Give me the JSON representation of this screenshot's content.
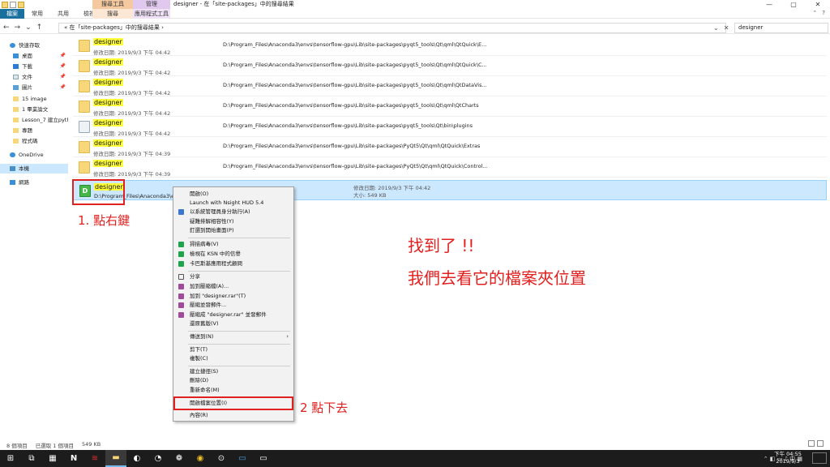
{
  "window": {
    "title": "designer - 在「site-packages」中的搜尋結果",
    "ctx_search_label": "搜尋工具",
    "ctx_manage_label": "管理",
    "ctrl_min": "—",
    "ctrl_max": "▢",
    "ctrl_close": "✕"
  },
  "ribbon": {
    "tabs": [
      "檔案",
      "常用",
      "共用",
      "檢視"
    ],
    "ctx_tabs": [
      "搜尋",
      "應用程式工具"
    ],
    "right": [
      "⌃",
      "?"
    ]
  },
  "address": {
    "path": "« 在「site-packages」中的搜尋結果 ›",
    "search_value": "designer",
    "nav_back": "←",
    "nav_forward": "→",
    "nav_recent": "⌄",
    "nav_up": "↑",
    "dropdown": "⌄",
    "close": "✕"
  },
  "sidebar": {
    "items": [
      {
        "label": "快速存取",
        "pinned": false
      },
      {
        "label": "桌面",
        "pinned": true
      },
      {
        "label": "下載",
        "pinned": true
      },
      {
        "label": "文件",
        "pinned": true
      },
      {
        "label": "圖片",
        "pinned": true
      },
      {
        "label": "15 image",
        "pinned": false
      },
      {
        "label": "1 畢業論文",
        "pinned": false
      },
      {
        "label": "Lesson_7 建立pyth",
        "pinned": false
      },
      {
        "label": "專題",
        "pinned": false
      },
      {
        "label": "程式碼",
        "pinned": false
      },
      {
        "label": "OneDrive",
        "pinned": false
      },
      {
        "label": "本機",
        "pinned": false
      },
      {
        "label": "網路",
        "pinned": false
      }
    ],
    "pin_glyph": "📌"
  },
  "results": [
    {
      "name": "designer",
      "meta": "修改日期: 2019/9/3 下午 04:42",
      "path": "D:\\Program_Files\\Anaconda3\\envs\\tensorflow-gpu\\Lib\\site-packages\\pyqt5_tools\\Qt\\qml\\QtQuick\\E..."
    },
    {
      "name": "designer",
      "meta": "修改日期: 2019/9/3 下午 04:42",
      "path": "D:\\Program_Files\\Anaconda3\\envs\\tensorflow-gpu\\Lib\\site-packages\\pyqt5_tools\\Qt\\qml\\QtQuick\\C..."
    },
    {
      "name": "designer",
      "meta": "修改日期: 2019/9/3 下午 04:42",
      "path": "D:\\Program_Files\\Anaconda3\\envs\\tensorflow-gpu\\Lib\\site-packages\\pyqt5_tools\\Qt\\qml\\QtDataVis..."
    },
    {
      "name": "designer",
      "meta": "修改日期: 2019/9/3 下午 04:42",
      "path": "D:\\Program_Files\\Anaconda3\\envs\\tensorflow-gpu\\Lib\\site-packages\\pyqt5_tools\\Qt\\qml\\QtCharts"
    },
    {
      "name": "designer",
      "meta": "修改日期: 2019/9/3 下午 04:42",
      "path": "D:\\Program_Files\\Anaconda3\\envs\\tensorflow-gpu\\Lib\\site-packages\\pyqt5_tools\\Qt\\bin\\plugins"
    },
    {
      "name": "designer",
      "meta": "修改日期: 2019/9/3 下午 04:39",
      "path": "D:\\Program_Files\\Anaconda3\\envs\\tensorflow-gpu\\Lib\\site-packages\\PyQt5\\Qt\\qml\\QtQuick\\Extras"
    },
    {
      "name": "designer",
      "meta": "修改日期: 2019/9/3 下午 04:39",
      "path": "D:\\Program_Files\\Anaconda3\\envs\\tensorflow-gpu\\Lib\\site-packages\\PyQt5\\Qt\\qml\\QtQuick\\Control..."
    }
  ],
  "selected": {
    "name": "designer",
    "path": "D:\\Program_Files\\Anaconda3\\en",
    "date": "修改日期: 2019/9/3 下午 04:42",
    "size": "大小: 549 KB",
    "icon_letter": "D"
  },
  "context_menu": [
    {
      "label": "開啟(O)"
    },
    {
      "label": "Launch with Nsight HUD 5.4"
    },
    {
      "label": "以系統管理員身分執行(A)",
      "icon": "shield"
    },
    {
      "label": "疑難排解相容性(Y)"
    },
    {
      "label": "釘選到開始畫面(P)"
    },
    {
      "sep": true
    },
    {
      "label": "掃描病毒(V)",
      "icon": "green"
    },
    {
      "label": "檢視在 KSN 中的信譽",
      "icon": "green"
    },
    {
      "label": "卡巴斯基應用程式顧問",
      "icon": "green"
    },
    {
      "sep": true
    },
    {
      "label": "分享",
      "icon": "share"
    },
    {
      "label": "加到壓縮檔(A)...",
      "icon": "rar"
    },
    {
      "label": "加到 \"designer.rar\"(T)",
      "icon": "rar"
    },
    {
      "label": "壓縮並發郵件...",
      "icon": "rar"
    },
    {
      "label": "壓縮成 \"designer.rar\" 並發郵件",
      "icon": "rar"
    },
    {
      "label": "還原舊版(V)"
    },
    {
      "sep": true
    },
    {
      "label": "傳送到(N)",
      "submenu": true
    },
    {
      "sep": true
    },
    {
      "label": "剪下(T)"
    },
    {
      "label": "複製(C)"
    },
    {
      "sep": true
    },
    {
      "label": "建立捷徑(S)"
    },
    {
      "label": "刪除(D)"
    },
    {
      "label": "重新命名(M)"
    },
    {
      "sep": true
    },
    {
      "label": "開啟檔案位置(I)",
      "highlight": true
    },
    {
      "sep": true
    },
    {
      "label": "內容(R)"
    }
  ],
  "annotations": {
    "step1": "1. 點右鍵",
    "step2": "2 點下去",
    "found": "找到了 !!",
    "goto": "我們去看它的檔案夾位置"
  },
  "status": {
    "count": "8 個項目",
    "selection": "已選取 1 個項目",
    "size": "549 KB"
  },
  "taskbar": {
    "icons": [
      "start-icon",
      "task-view-icon",
      "calculator-icon",
      "nvidia-icon",
      "app-icon",
      "file-explorer-icon",
      "app2-icon",
      "app3-icon",
      "app4-icon",
      "chrome-icon",
      "app5-icon",
      "app6-icon",
      "terminal-icon"
    ],
    "glyphs": [
      "⊞",
      "⧉",
      "▦",
      "N",
      "≋",
      "▬",
      "◐",
      "◔",
      "❁",
      "◉",
      "⊙",
      "▭",
      "▭"
    ],
    "time": "下午 04:55",
    "date": "2019/9/3",
    "tray": "⌃ ◧ ▭ ♪ 中 ▦"
  },
  "colors": {
    "accent": "#19709f",
    "selection": "#cce8ff",
    "highlight": "#ffff3a",
    "annotation": "#e12020"
  }
}
